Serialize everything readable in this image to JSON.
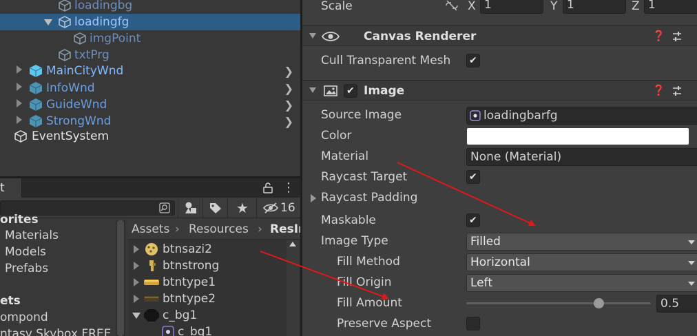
{
  "hierarchy": {
    "items": [
      {
        "label": "loadingbg"
      },
      {
        "label": "loadingfg"
      },
      {
        "label": "imgPoint"
      },
      {
        "label": "txtPrg"
      },
      {
        "label": "MainCityWnd"
      },
      {
        "label": "InfoWnd"
      },
      {
        "label": "GuideWnd"
      },
      {
        "label": "StrongWnd"
      },
      {
        "label": "EventSystem"
      }
    ]
  },
  "project": {
    "tab_label": "t",
    "hidden_count": "16",
    "favorites_heading": "orites",
    "favorites": [
      "Materials",
      "Models",
      "Prefabs"
    ],
    "assets_heading": "ets",
    "assets_tree": [
      "ompond",
      "ntasy Skybox FREE"
    ],
    "breadcrumb": {
      "assets": "Assets",
      "resources": "Resources",
      "current": "ResIm"
    },
    "assets": [
      {
        "label": "btnsazi2"
      },
      {
        "label": "btnstrong"
      },
      {
        "label": "btntype1"
      },
      {
        "label": "btntype2"
      },
      {
        "label": "c_bg1"
      },
      {
        "label": "c_bg1"
      }
    ]
  },
  "inspector": {
    "scale": {
      "label": "Scale",
      "x_label": "X",
      "x": "1",
      "y_label": "Y",
      "y": "1",
      "z_label": "Z",
      "z": "1"
    },
    "canvas_renderer": {
      "title": "Canvas Renderer",
      "cull_label": "Cull Transparent Mesh",
      "cull_checked": true
    },
    "image": {
      "title": "Image",
      "source_image_label": "Source Image",
      "source_image_value": "loadingbarfg",
      "color_label": "Color",
      "color_value": "#ffffff",
      "material_label": "Material",
      "material_value": "None (Material)",
      "raycast_target_label": "Raycast Target",
      "raycast_padding_label": "Raycast Padding",
      "maskable_label": "Maskable",
      "image_type_label": "Image Type",
      "image_type_value": "Filled",
      "fill_method_label": "Fill Method",
      "fill_method_value": "Horizontal",
      "fill_origin_label": "Fill Origin",
      "fill_origin_value": "Left",
      "fill_amount_label": "Fill Amount",
      "fill_amount_value": "0.5",
      "fill_amount_fraction": 0.5,
      "preserve_aspect_label": "Preserve Aspect"
    }
  },
  "colors": {
    "selection": "#2c5d87",
    "annotation_arrow": "#e01818"
  }
}
